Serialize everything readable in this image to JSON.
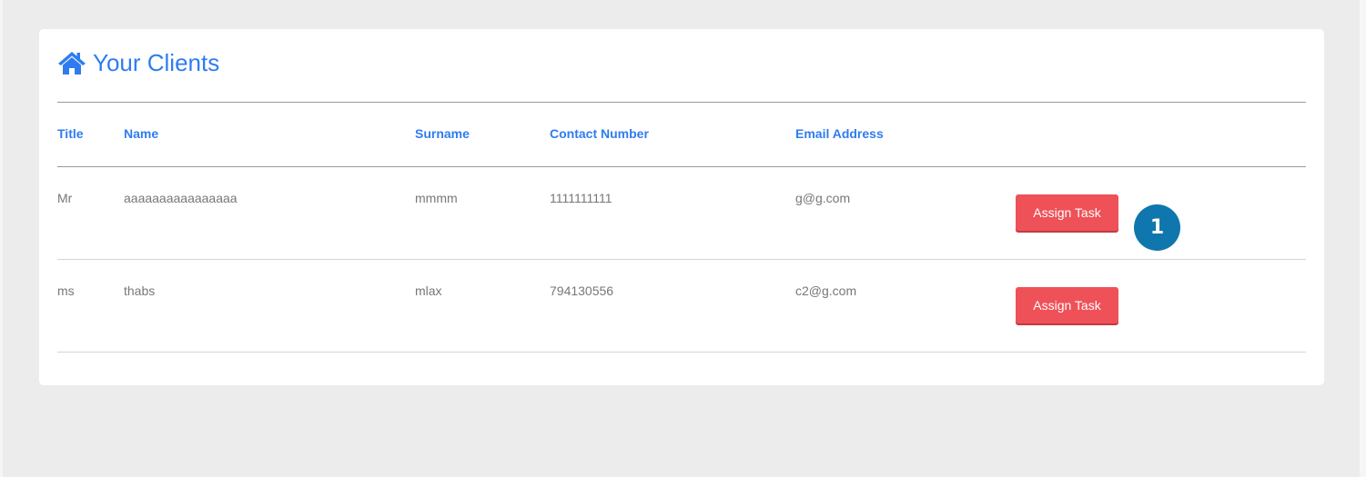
{
  "page": {
    "title": "Your Clients",
    "title_icon": "home-icon",
    "accent_color": "#2f7cf0"
  },
  "table": {
    "columns": [
      "Title",
      "Name",
      "Surname",
      "Contact Number",
      "Email Address"
    ],
    "rows": [
      {
        "title": "Mr",
        "name": "aaaaaaaaaaaaaaaa",
        "surname": "mmmm",
        "contact": "1111111111",
        "email": "g@g.com",
        "action": "Assign Task"
      },
      {
        "title": "ms",
        "name": "thabs",
        "surname": "mlax",
        "contact": "794130556",
        "email": "c2@g.com",
        "action": "Assign Task"
      }
    ]
  },
  "annotation": {
    "badge_label": "1",
    "badge_color": "#0f77ad"
  },
  "button_color": "#ef5158"
}
